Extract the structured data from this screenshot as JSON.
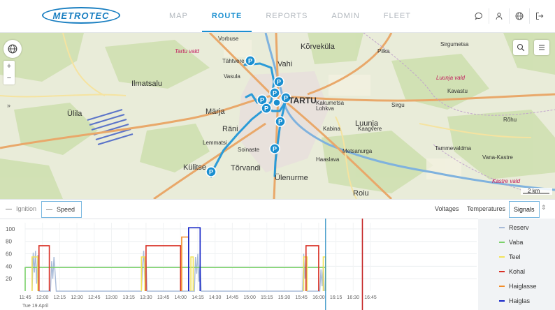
{
  "app": {
    "logo_text": "METROTEC"
  },
  "nav": {
    "items": [
      "MAP",
      "ROUTE",
      "REPORTS",
      "ADMIN",
      "FLEET"
    ],
    "active": "ROUTE"
  },
  "header_icons": [
    "chat-icon",
    "user-icon",
    "globe-icon",
    "logout-icon"
  ],
  "map": {
    "zoom_in": "+",
    "zoom_out": "−",
    "expand": "»",
    "scale": "2 km",
    "places": [
      {
        "name": "Vorbuse"
      },
      {
        "name": "Vahi"
      },
      {
        "name": "Kõrveküla"
      },
      {
        "name": "Tähtvere"
      },
      {
        "name": "Ilmatsalu"
      },
      {
        "name": "TARTU"
      },
      {
        "name": "Ülila"
      },
      {
        "name": "Märja"
      },
      {
        "name": "Räni"
      },
      {
        "name": "Lohkva"
      },
      {
        "name": "Luunja"
      },
      {
        "name": "Kabina"
      },
      {
        "name": "Kaagvere"
      },
      {
        "name": "Lemmatsi"
      },
      {
        "name": "Soinaste"
      },
      {
        "name": "Külitse"
      },
      {
        "name": "Tõrvandi"
      },
      {
        "name": "Ülenurme"
      },
      {
        "name": "Roiu"
      },
      {
        "name": "Haaslava"
      },
      {
        "name": "Metsanurga"
      },
      {
        "name": "Tammevaldma"
      },
      {
        "name": "Sirgu"
      },
      {
        "name": "Kavastu"
      },
      {
        "name": "Luunja vald"
      },
      {
        "name": "Kastre vald"
      },
      {
        "name": "Sirgumetsa"
      },
      {
        "name": "Pilka"
      },
      {
        "name": "Kakumetsa"
      },
      {
        "name": "Rõhu"
      },
      {
        "name": "Vana-Kastre"
      },
      {
        "name": "Vasula"
      },
      {
        "name": "Tartu vald"
      }
    ]
  },
  "tabs_left": [
    {
      "label": "Ignition",
      "active": false
    },
    {
      "label": "Speed",
      "active": true
    }
  ],
  "tabs_right": [
    {
      "label": "Voltages",
      "active": false
    },
    {
      "label": "Temperatures",
      "active": false
    },
    {
      "label": "Signals",
      "active": true
    }
  ],
  "chart_data": {
    "type": "line",
    "ylim": [
      0,
      110
    ],
    "yticks": [
      "20",
      "40",
      "60",
      "80",
      "100"
    ],
    "x_ticks": [
      "11:45",
      "12:00",
      "12:15",
      "12:30",
      "12:45",
      "13:00",
      "13:15",
      "13:30",
      "13:45",
      "14:00",
      "14:15",
      "14:30",
      "14:45",
      "15:00",
      "15:15",
      "15:30",
      "15:45",
      "16:00",
      "16:15",
      "16:30",
      "16:45"
    ],
    "date_label": "Tue 19 April",
    "markers": {
      "blue_line": "16:06",
      "red_line": "16:38"
    },
    "series": [
      {
        "name": "Vaba",
        "color": "#7bd16a",
        "segments": [
          [
            "11:45",
            38
          ],
          [
            "16:06",
            38
          ]
        ]
      },
      {
        "name": "Teel",
        "color": "#f2e35a",
        "segments": [
          [
            "11:51",
            55
          ],
          [
            "11:56",
            55
          ],
          [
            "13:26",
            55
          ],
          [
            "13:29",
            55
          ],
          [
            "14:09",
            55
          ],
          [
            "14:11",
            55
          ],
          [
            "15:47",
            55
          ],
          [
            "15:50",
            55
          ],
          [
            "16:04",
            55
          ],
          [
            "16:06",
            55
          ]
        ]
      },
      {
        "name": "Kohal",
        "color": "#d93025",
        "segments": [
          [
            "11:57",
            73
          ],
          [
            "12:06",
            73
          ],
          [
            "13:30",
            73
          ],
          [
            "14:00",
            73
          ],
          [
            "15:49",
            73
          ],
          [
            "16:00",
            73
          ]
        ]
      },
      {
        "name": "Haiglasse",
        "color": "#f28c28",
        "segments": [
          [
            "14:01",
            87
          ],
          [
            "14:07",
            87
          ]
        ]
      },
      {
        "name": "Haiglas",
        "color": "#1424c8",
        "segments": [
          [
            "14:07",
            102
          ],
          [
            "14:17",
            102
          ]
        ]
      }
    ],
    "speed": {
      "name": "Speed",
      "color": "#a8bbd8",
      "times": [
        "11:51",
        "11:52",
        "11:53",
        "11:54",
        "11:55",
        "11:56",
        "11:57",
        "11:58",
        "11:59",
        "12:00",
        "12:01",
        "12:02",
        "12:03",
        "12:04",
        "12:05",
        "12:06",
        "12:07",
        "12:08",
        "12:09",
        "12:10",
        "12:11",
        "12:12",
        "13:26",
        "13:27",
        "13:28",
        "13:29",
        "13:30",
        "13:31",
        "14:12",
        "14:13",
        "14:14",
        "14:15",
        "14:16",
        "14:17",
        "14:18",
        "15:46",
        "15:47",
        "15:48",
        "15:49",
        "15:50",
        "16:01",
        "16:02",
        "16:03",
        "16:04",
        "16:05"
      ],
      "values": [
        0,
        62,
        30,
        65,
        12,
        58,
        0,
        0,
        0,
        0,
        0,
        0,
        0,
        0,
        0,
        0,
        0,
        48,
        20,
        55,
        30,
        0,
        0,
        40,
        65,
        10,
        50,
        0,
        0,
        55,
        28,
        60,
        15,
        45,
        0,
        0,
        60,
        20,
        58,
        0,
        0,
        35,
        8,
        42,
        0
      ]
    },
    "legend": [
      {
        "label": "Reserv",
        "color": "#a8bbd8"
      },
      {
        "label": "Vaba",
        "color": "#7bd16a"
      },
      {
        "label": "Teel",
        "color": "#f2e35a"
      },
      {
        "label": "Kohal",
        "color": "#d93025"
      },
      {
        "label": "Haiglasse",
        "color": "#f28c28"
      },
      {
        "label": "Haiglas",
        "color": "#1424c8"
      }
    ]
  }
}
